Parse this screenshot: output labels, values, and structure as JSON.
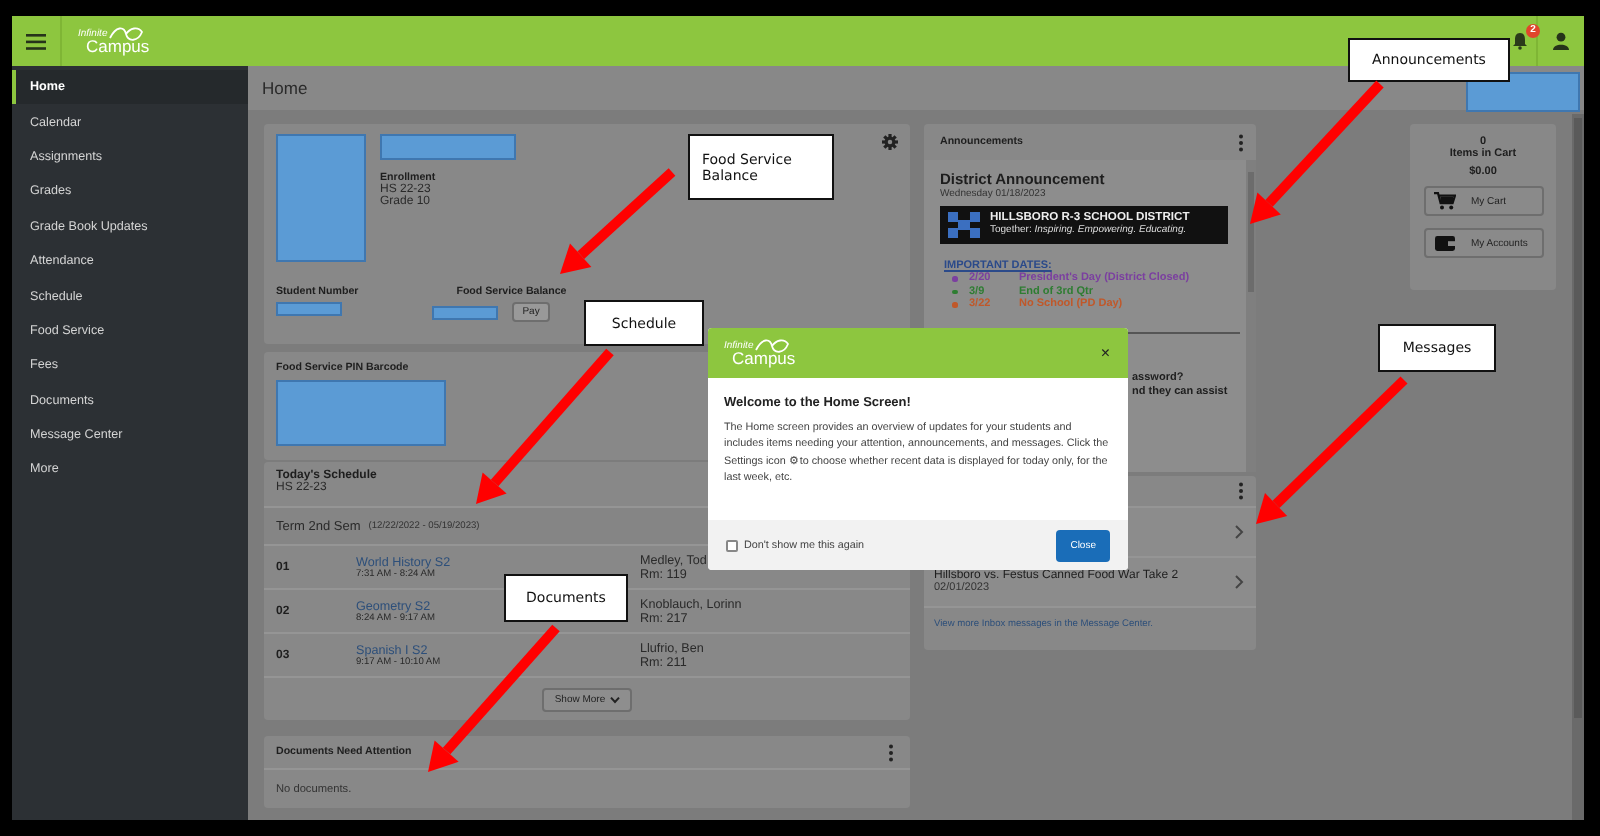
{
  "top_bar": {
    "logo": {
      "line1": "Infinite",
      "line2": "Campus"
    },
    "notification_count": "2"
  },
  "sidebar": {
    "items": [
      {
        "label": "Home",
        "selected": true
      },
      {
        "label": "Calendar",
        "selected": false
      },
      {
        "label": "Assignments",
        "selected": false
      },
      {
        "label": "Grades",
        "selected": false
      },
      {
        "label": "Grade Book Updates",
        "selected": false
      },
      {
        "label": "Attendance",
        "selected": false
      },
      {
        "label": "Schedule",
        "selected": false
      },
      {
        "label": "Food Service",
        "selected": false
      },
      {
        "label": "Fees",
        "selected": false
      },
      {
        "label": "Documents",
        "selected": false
      },
      {
        "label": "Message Center",
        "selected": false
      },
      {
        "label": "More",
        "selected": false
      }
    ]
  },
  "page_title": "Home",
  "student_card": {
    "enrollment_label": "Enrollment",
    "enrollment_year": "HS 22-23",
    "grade": "Grade 10",
    "student_number_label": "Student Number",
    "food_balance_label": "Food Service Balance",
    "pay_button": "Pay"
  },
  "barcode_card": {
    "title": "Food Service PIN Barcode"
  },
  "schedule_card": {
    "title": "Today's Schedule",
    "subtitle": "HS 22-23",
    "term": "Term 2nd Sem",
    "term_dates": "(12/22/2022 - 05/19/2023)",
    "rows": [
      {
        "period": "01",
        "course": "World History S2",
        "time": "7:31 AM - 8:24 AM",
        "teacher": "Medley, Tod",
        "room": "Rm: 119"
      },
      {
        "period": "02",
        "course": "Geometry S2",
        "time": "8:24 AM - 9:17 AM",
        "teacher": "Knoblauch, Lorinn",
        "room": "Rm: 217"
      },
      {
        "period": "03",
        "course": "Spanish I S2",
        "time": "9:17 AM - 10:10 AM",
        "teacher": "Llufrio, Ben",
        "room": "Rm: 211"
      }
    ],
    "show_more": "Show More"
  },
  "documents_card": {
    "title": "Documents Need Attention",
    "empty_text": "No documents."
  },
  "announcements_card": {
    "title": "Announcements",
    "heading": "District Announcement",
    "date": "Wednesday 01/18/2023",
    "banner": {
      "title": "HILLSBORO R-3 SCHOOL DISTRICT",
      "tagline": "Together: *Inspiring. Empowering. Educating.*"
    },
    "dates_heading": "IMPORTANT DATES:",
    "dates": [
      {
        "date": "2/20",
        "event": "President's Day (District Closed)",
        "color": "#7b3fa0"
      },
      {
        "date": "3/9",
        "event": "End of 3rd Qtr",
        "color": "#2e7d32"
      },
      {
        "date": "3/22",
        "event": "No School (PD Day)",
        "color": "#c0582a"
      }
    ],
    "covered_lines": [
      "assword?",
      "nd they can assist"
    ]
  },
  "messages_card": {
    "messages": [
      {
        "kind": "covered"
      },
      {
        "kind": "message",
        "title": "Hillsboro vs. Festus Canned Food War Take 2",
        "date": "02/01/2023"
      }
    ],
    "footer_link": "View more Inbox messages in the Message Center."
  },
  "cart_card": {
    "count": "0",
    "count_label": "Items in Cart",
    "total": "$0.00",
    "buttons": [
      {
        "label": "My Cart",
        "kind": "cart"
      },
      {
        "label": "My Accounts",
        "kind": "wallet"
      }
    ]
  },
  "welcome_dialog": {
    "logo": {
      "line1": "Infinite",
      "line2": "Campus"
    },
    "close_glyph": "×",
    "title": "Welcome to the Home Screen!",
    "text": "The Home screen provides an overview of updates for your students and includes items needing your attention, announcements, and messages. Click the Settings icon ⚙ to choose whether recent data is displayed for today only, for the last week, etc.",
    "checkbox": {
      "label": "Don't show me this again",
      "checked": false
    },
    "close_button": "Close"
  },
  "annotations": [
    {
      "text": "Food Service Balance"
    },
    {
      "text": "Announcements"
    },
    {
      "text": "Schedule"
    },
    {
      "text": "Messages"
    },
    {
      "text": "Documents"
    }
  ]
}
